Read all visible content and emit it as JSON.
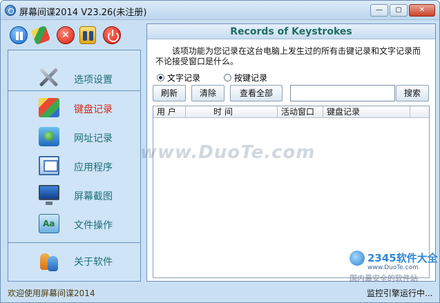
{
  "window": {
    "title": "屏幕间谍2014 V23.26(未注册)",
    "minimize": "—",
    "maximize": "▢",
    "close": "✕"
  },
  "toolbar": {
    "pause": "pause-icon",
    "clear_records": "eraser-icon",
    "delete": "delete-icon",
    "keys": "keys-icon",
    "exit": "power-icon",
    "delete_glyph": "✕"
  },
  "sidebar": {
    "items": [
      {
        "label": "选项设置",
        "icon": "tools-icon"
      },
      {
        "label": "键盘记录",
        "icon": "keyboard-icon",
        "active": true
      },
      {
        "label": "网址记录",
        "icon": "web-icon"
      },
      {
        "label": "应用程序",
        "icon": "app-window-icon"
      },
      {
        "label": "屏幕截图",
        "icon": "monitor-icon"
      },
      {
        "label": "文件操作",
        "icon": "file-icon"
      },
      {
        "label": "关于软件",
        "icon": "users-icon"
      }
    ],
    "active_color": "#d42a1c",
    "label_color": "#1c6f78"
  },
  "panel": {
    "title": "Records of Keystrokes",
    "description": "该项功能为您记录在这台电脑上发生过的所有击键记录和文字记录而不论接受窗口是什么。",
    "radio_text": "文字记录",
    "radio_keys": "按键记录",
    "btn_refresh": "刷新",
    "btn_clear": "清除",
    "btn_viewall": "查看全部",
    "search_value": "",
    "btn_search": "搜索",
    "columns": [
      "用 户",
      "时     间",
      "活动窗口",
      "键盘记录",
      ""
    ]
  },
  "watermark": "www.DuoTe.com",
  "status": {
    "left": "欢迎使用屏幕间谍2014",
    "right": "监控引擎运行中..."
  },
  "badge": {
    "brand": "2345软件大全",
    "site": "www.DuoTe.com",
    "slogan": "国内最安全的软件站"
  }
}
